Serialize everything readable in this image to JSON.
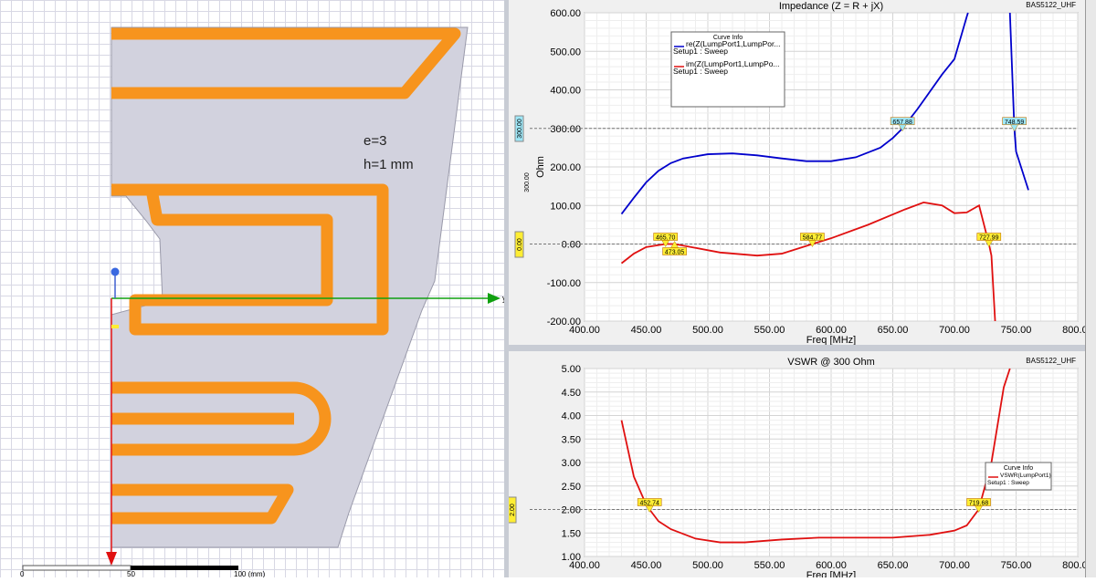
{
  "geometry_view": {
    "annotations": {
      "permittivity": "e=3",
      "height": "h=1 mm"
    },
    "axis_label_y": "y",
    "scale": {
      "labels": [
        "0",
        "50",
        "100 (mm)"
      ]
    }
  },
  "impedance_plot": {
    "title": "Impedance (Z = R + jX)",
    "project": "BAS5122_UHF",
    "legend_title": "Curve Info",
    "side_labels": [
      "300.00",
      "300.00",
      "0.00"
    ],
    "chart_data": {
      "type": "line",
      "title": "Impedance (Z = R + jX)",
      "xlabel": "Freq [MHz]",
      "ylabel": "Ohm",
      "xlim": [
        400,
        800
      ],
      "ylim": [
        -200,
        600
      ],
      "xticks": [
        "400.00",
        "450.00",
        "500.00",
        "550.00",
        "600.00",
        "650.00",
        "700.00",
        "750.00",
        "800.00"
      ],
      "yticks": [
        "600.00",
        "500.00",
        "400.00",
        "300.00",
        "200.00",
        "100.00",
        "0.00",
        "-100.00",
        "-200.00"
      ],
      "reference_lines": [
        300,
        0
      ],
      "series": [
        {
          "name": "re(Z(LumpPort1,LumpPor...",
          "setup": "Setup1 : Sweep",
          "color": "#0000cc",
          "segments": [
            [
              [
                430,
                78
              ],
              [
                440,
                120
              ],
              [
                450,
                160
              ],
              [
                460,
                190
              ],
              [
                470,
                210
              ],
              [
                480,
                222
              ],
              [
                500,
                233
              ],
              [
                520,
                235
              ],
              [
                540,
                230
              ],
              [
                560,
                222
              ],
              [
                580,
                215
              ],
              [
                600,
                215
              ],
              [
                620,
                225
              ],
              [
                640,
                250
              ],
              [
                650,
                275
              ],
              [
                657.88,
                300
              ],
              [
                670,
                350
              ],
              [
                690,
                440
              ],
              [
                700,
                480
              ],
              [
                710,
                590
              ],
              [
                711,
                600
              ]
            ],
            [
              [
                745,
                600
              ],
              [
                748.59,
                300
              ],
              [
                750,
                240
              ],
              [
                760,
                140
              ]
            ]
          ]
        },
        {
          "name": "im(Z(LumpPort1,LumpPo...",
          "setup": "Setup1 : Sweep",
          "color": "#e01010",
          "segments": [
            [
              [
                430,
                -50
              ],
              [
                440,
                -25
              ],
              [
                450,
                -8
              ],
              [
                465.7,
                0
              ],
              [
                473.05,
                0
              ],
              [
                490,
                -10
              ],
              [
                510,
                -22
              ],
              [
                540,
                -30
              ],
              [
                560,
                -25
              ],
              [
                584.77,
                0
              ],
              [
                600,
                15
              ],
              [
                630,
                50
              ],
              [
                660,
                90
              ],
              [
                675,
                108
              ],
              [
                690,
                100
              ],
              [
                700,
                80
              ],
              [
                710,
                82
              ],
              [
                720,
                100
              ],
              [
                727.99,
                0
              ],
              [
                730,
                -30
              ],
              [
                733,
                -200
              ]
            ]
          ]
        }
      ],
      "markers": [
        {
          "label": "657.88",
          "x": 657.88,
          "y": 300,
          "color": "#9ee7f7"
        },
        {
          "label": "748.59",
          "x": 748.59,
          "y": 300,
          "color": "#9ee7f7"
        },
        {
          "label": "465.70",
          "x": 465.7,
          "y": 0,
          "color": "#ffee33"
        },
        {
          "label": "473.05",
          "x": 473.05,
          "y": 0,
          "color": "#ffee33",
          "below": true
        },
        {
          "label": "584.77",
          "x": 584.77,
          "y": 0,
          "color": "#ffee33"
        },
        {
          "label": "727.99",
          "x": 727.99,
          "y": 0,
          "color": "#ffee33"
        }
      ]
    }
  },
  "vswr_plot": {
    "title": "VSWR @ 300 Ohm",
    "project": "BAS5122_UHF",
    "legend_title": "Curve Info",
    "side_labels": [
      "2.00"
    ],
    "chart_data": {
      "type": "line",
      "title": "VSWR @ 300 Ohm",
      "xlabel": "Freq [MHz]",
      "ylabel": "",
      "xlim": [
        400,
        800
      ],
      "ylim": [
        1,
        5
      ],
      "xticks": [
        "400.00",
        "450.00",
        "500.00",
        "550.00",
        "600.00",
        "650.00",
        "700.00",
        "750.00",
        "800.00"
      ],
      "yticks": [
        "5.00",
        "4.50",
        "4.00",
        "3.50",
        "3.00",
        "2.50",
        "2.00",
        "1.50",
        "1.00"
      ],
      "reference_lines": [
        2
      ],
      "series": [
        {
          "name": "VSWR(LumpPort1)",
          "setup": "Setup1 : Sweep",
          "color": "#e01010",
          "segments": [
            [
              [
                430,
                3.9
              ],
              [
                440,
                2.7
              ],
              [
                450,
                2.1
              ],
              [
                452.74,
                2.0
              ],
              [
                460,
                1.75
              ],
              [
                470,
                1.58
              ],
              [
                490,
                1.38
              ],
              [
                510,
                1.3
              ],
              [
                530,
                1.3
              ],
              [
                560,
                1.36
              ],
              [
                590,
                1.4
              ],
              [
                620,
                1.4
              ],
              [
                650,
                1.4
              ],
              [
                680,
                1.46
              ],
              [
                700,
                1.55
              ],
              [
                710,
                1.66
              ],
              [
                719.68,
                2.0
              ],
              [
                730,
                3.0
              ],
              [
                740,
                4.6
              ],
              [
                745,
                5.0
              ]
            ]
          ]
        }
      ],
      "markers": [
        {
          "label": "452.74",
          "x": 452.74,
          "y": 2,
          "color": "#ffee33"
        },
        {
          "label": "719.68",
          "x": 719.68,
          "y": 2,
          "color": "#ffee33"
        }
      ]
    }
  }
}
